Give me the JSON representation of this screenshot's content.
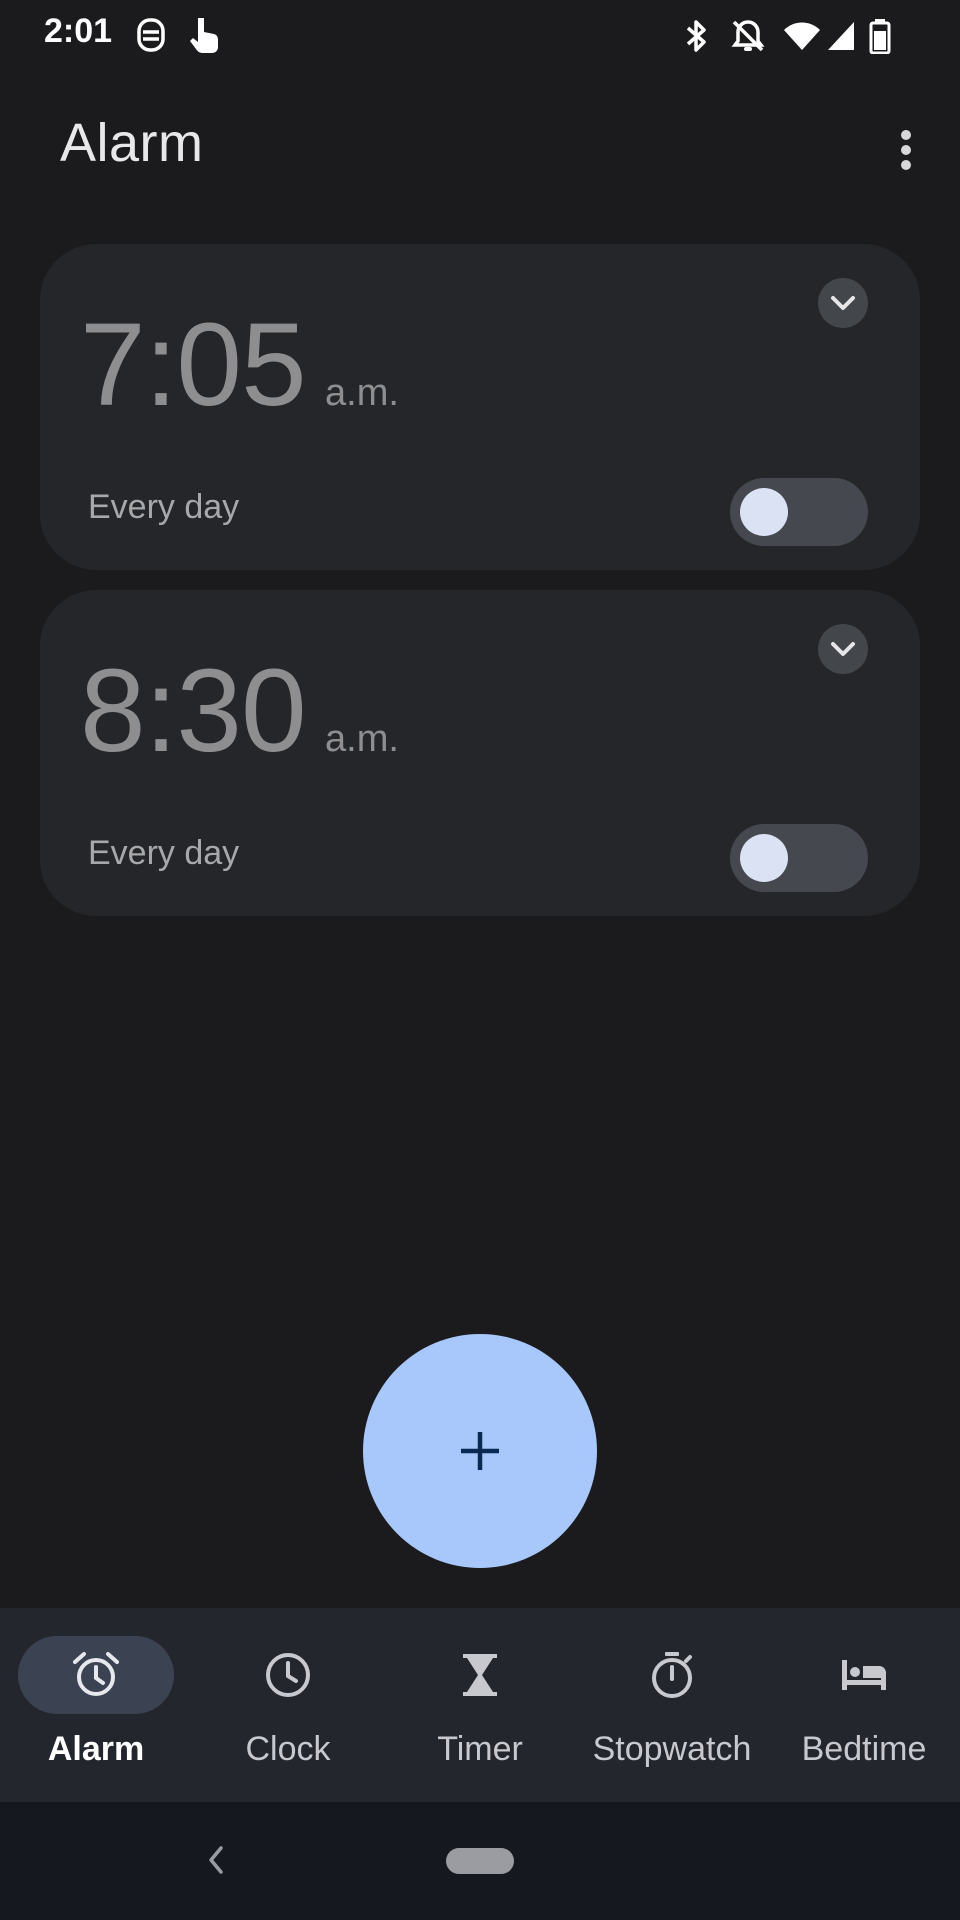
{
  "status_bar": {
    "time": "2:01",
    "left_icons": [
      "assistant-face-icon",
      "touch-hand-icon"
    ],
    "right_icons": [
      "bluetooth-icon",
      "notifications-off-icon",
      "wifi-icon",
      "signal-icon",
      "battery-icon"
    ]
  },
  "app_bar": {
    "title": "Alarm",
    "overflow_icon": "more-vert-icon"
  },
  "alarms": [
    {
      "time": "7:05",
      "period": "a.m.",
      "repeat": "Every day",
      "enabled": false
    },
    {
      "time": "8:30",
      "period": "a.m.",
      "repeat": "Every day",
      "enabled": false
    }
  ],
  "fab": {
    "icon": "add-icon"
  },
  "bottom_nav": {
    "items": [
      {
        "label": "Alarm",
        "icon": "alarm-icon",
        "active": true
      },
      {
        "label": "Clock",
        "icon": "clock-icon",
        "active": false
      },
      {
        "label": "Timer",
        "icon": "hourglass-icon",
        "active": false
      },
      {
        "label": "Stopwatch",
        "icon": "stopwatch-icon",
        "active": false
      },
      {
        "label": "Bedtime",
        "icon": "bed-icon",
        "active": false
      }
    ]
  },
  "system_nav": {
    "back_icon": "back-chevron-icon",
    "home_icon": "home-pill-icon"
  },
  "colors": {
    "background": "#1b1b1d",
    "card": "#252629",
    "fab": "#a8c7fa",
    "nav_bar": "#24262d",
    "active_pill": "#3b4252"
  }
}
